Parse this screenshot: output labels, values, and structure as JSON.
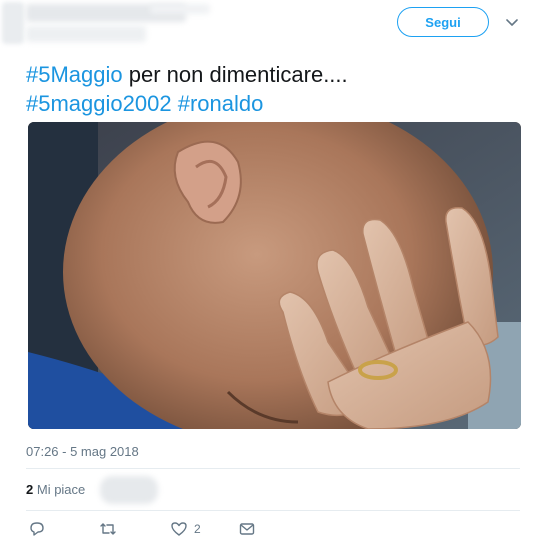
{
  "header": {
    "follow_label": "Segui",
    "chevron_icon": "chevron-down-icon"
  },
  "tweet": {
    "hashtag_1": "#5Maggio",
    "text_1": " per non dimenticare....",
    "hashtag_2": "#5maggio2002",
    "hashtag_3": "#ronaldo",
    "timestamp": "07:26 - 5 mag 2018",
    "likes_count": "2",
    "likes_label": "Mi piace"
  },
  "actions": {
    "reply_icon": "reply-icon",
    "retweet_icon": "retweet-icon",
    "like_icon": "heart-icon",
    "like_count": "2",
    "message_icon": "envelope-icon"
  },
  "colors": {
    "accent": "#1da1f2",
    "hashtag": "#1b95e0",
    "muted": "#657786"
  }
}
